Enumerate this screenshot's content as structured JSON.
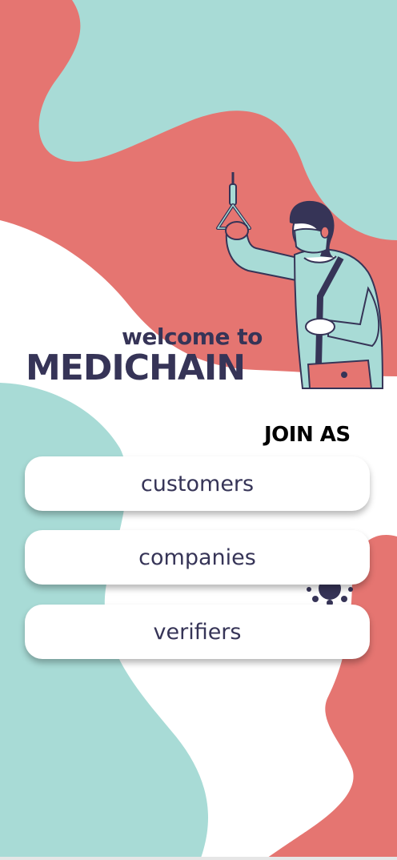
{
  "header": {
    "welcome_text": "welcome to",
    "app_name": "MEDICHAIN"
  },
  "join": {
    "heading": "JOIN AS",
    "options": [
      {
        "label": "customers"
      },
      {
        "label": "companies"
      },
      {
        "label": "verifiers"
      }
    ]
  },
  "illustration": {
    "subject": "masked commuter holding strap",
    "icon": "person-with-mask-illustration"
  },
  "colors": {
    "teal": "#a8dbd6",
    "coral": "#e57571",
    "navy": "#363457",
    "white": "#ffffff"
  }
}
